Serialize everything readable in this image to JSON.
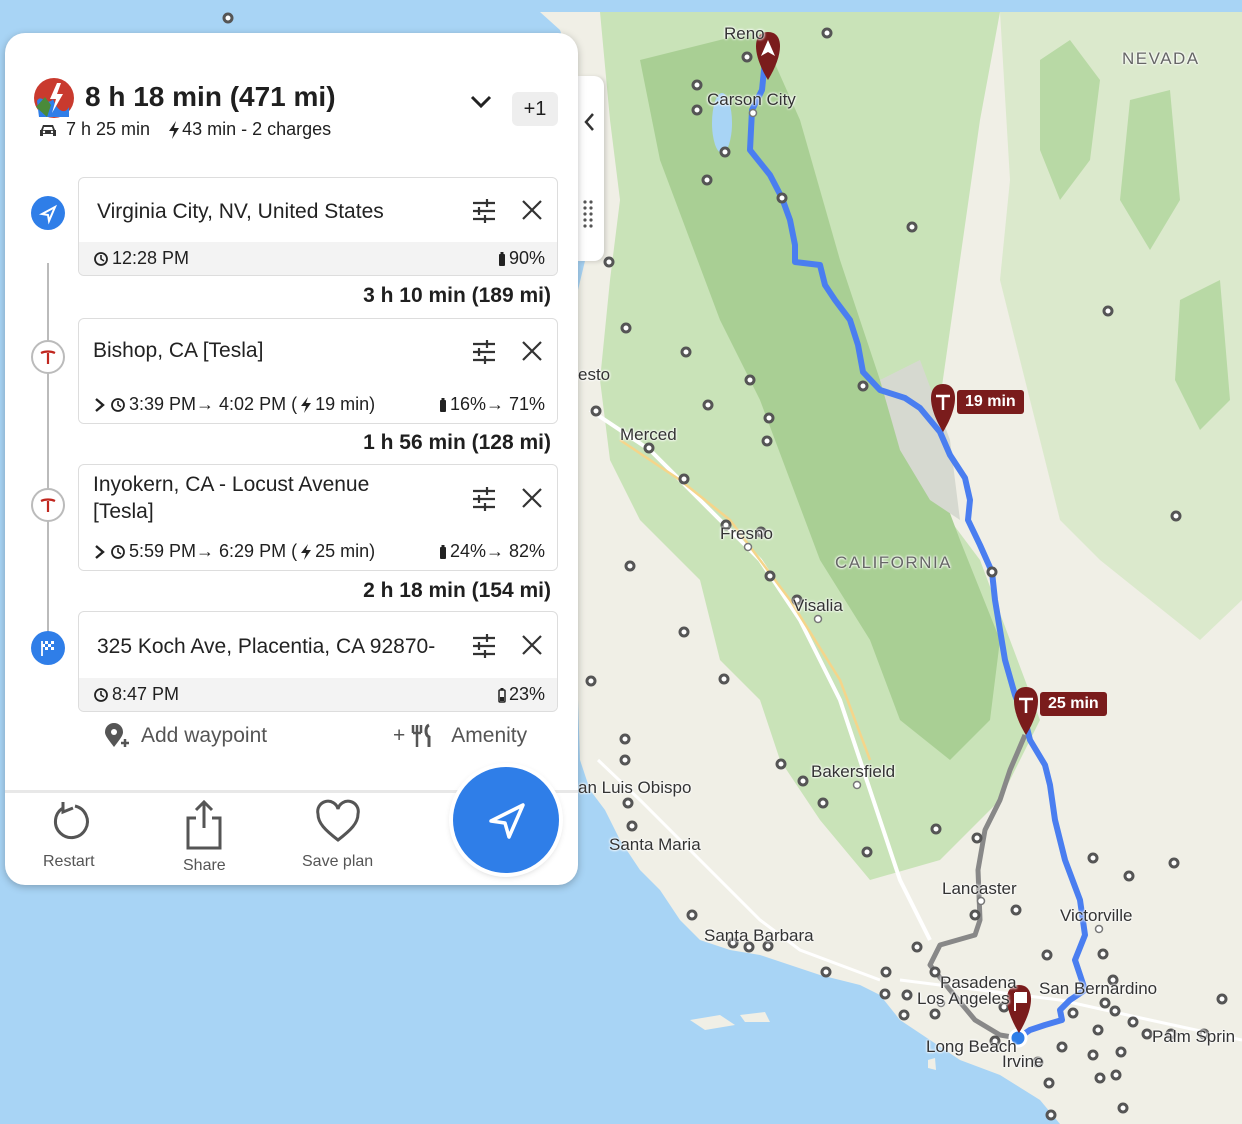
{
  "summary": {
    "title": "8 h 18 min (471 mi)",
    "drive_time": "7 h 25 min",
    "charge_time": "43 min - 2 charges",
    "extra_badge": "+1"
  },
  "stops": [
    {
      "name": "Virginia City, NV, United States",
      "time": "12:28 PM",
      "battery": "90%"
    },
    {
      "name": "Bishop, CA [Tesla]",
      "time": "3:39 PM→ 4:02 PM (",
      "charge": "19 min)",
      "battery": "16%→ 71%"
    },
    {
      "name_line1": "Inyokern, CA - Locust Avenue",
      "name_line2": "[Tesla]",
      "time": "5:59 PM→ 6:29 PM (",
      "charge": "25 min)",
      "battery": "24%→ 82%"
    },
    {
      "name": "325 Koch Ave, Placentia, CA 92870-",
      "time": "8:47 PM",
      "battery": "23%"
    }
  ],
  "legs": [
    "3 h 10 min (189 mi)",
    "1 h 56 min (128 mi)",
    "2 h 18 min (154 mi)"
  ],
  "actions": {
    "add_waypoint": "Add waypoint",
    "amenity": "Amenity",
    "amenity_prefix": "+"
  },
  "buttons": {
    "restart": "Restart",
    "share": "Share",
    "save_plan": "Save plan"
  },
  "map": {
    "labels": {
      "reno": "Reno",
      "carson_city": "Carson City",
      "nevada": "NEVADA",
      "california": "CALIFORNIA",
      "modesto": "esto",
      "merced": "Merced",
      "fresno": "Fresno",
      "visalia": "Visalia",
      "bakersfield": "Bakersfield",
      "san_luis_obispo": "an Luis Obispo",
      "santa_maria": "Santa Maria",
      "santa_barbara": "Santa Barbara",
      "lancaster": "Lancaster",
      "victorville": "Victorville",
      "pasadena": "Pasadena",
      "los_angeles": "Los Angeles",
      "san_bernardino": "San Bernardino",
      "long_beach": "Long Beach",
      "irvine": "Irvine",
      "palm_springs": "Palm Sprin"
    },
    "charger_badges": [
      "19 min",
      "25 min"
    ],
    "route_color": "#4a7ef0",
    "alt_route_color": "#888888",
    "charger_color": "#7a1c1c"
  }
}
